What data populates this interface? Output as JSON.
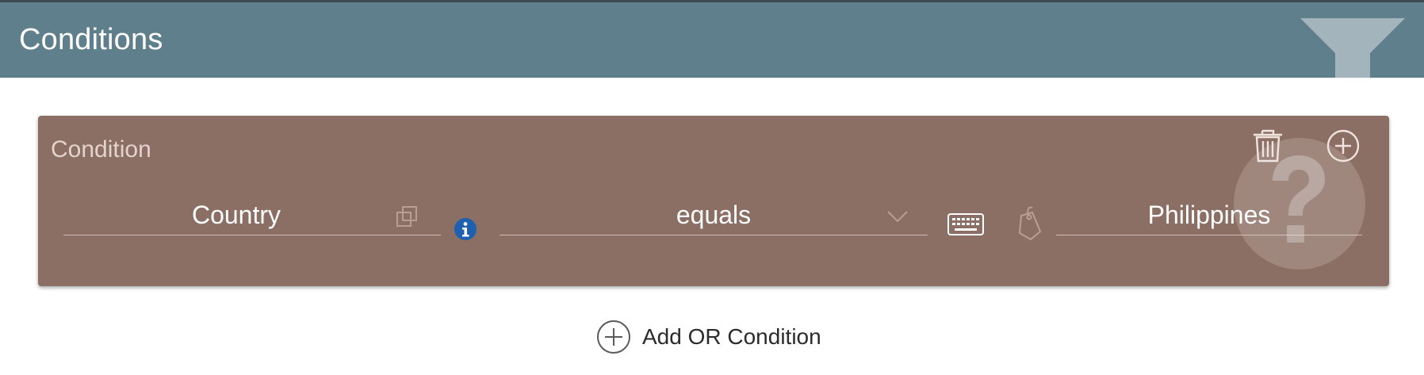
{
  "header": {
    "title": "Conditions",
    "icon": "filter-icon",
    "color": "#5f7f8d"
  },
  "condition_card": {
    "title": "Condition",
    "color": "#8c6f64",
    "actions": {
      "delete_icon": "trash-icon",
      "add_icon": "plus-circle-icon"
    },
    "help_icon": "question-mark-icon",
    "field": {
      "value": "Country",
      "icon": "copy-icon"
    },
    "info_icon": "info-icon",
    "operator": {
      "value": "equals",
      "icon": "chevron-down-icon"
    },
    "value_mode_icons": [
      "keyboard-icon",
      "tag-icon"
    ],
    "value": {
      "value": "Philippines"
    }
  },
  "footer": {
    "add_or_label": "Add OR Condition",
    "add_or_icon": "plus-circle-icon"
  },
  "colors": {
    "info": "#1f5fb0",
    "text_light": "#ffffff"
  }
}
